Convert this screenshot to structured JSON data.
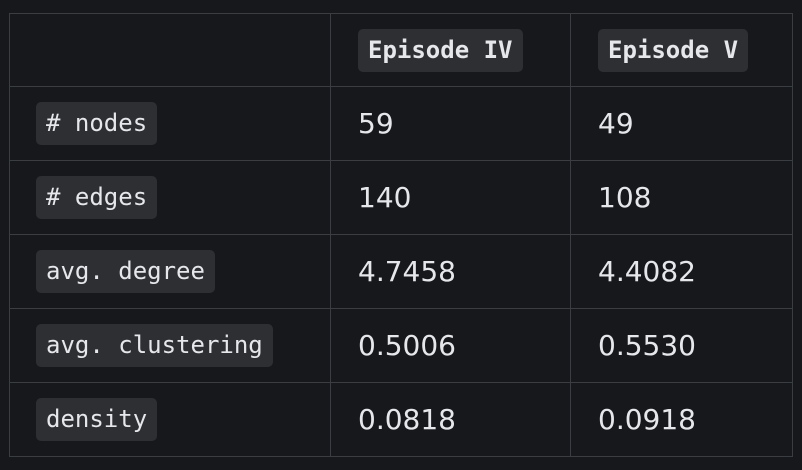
{
  "table": {
    "headers": [
      "",
      "Episode IV",
      "Episode V"
    ],
    "rows": [
      {
        "label": "# nodes",
        "values": [
          "59",
          "49"
        ]
      },
      {
        "label": "# edges",
        "values": [
          "140",
          "108"
        ]
      },
      {
        "label": "avg. degree",
        "values": [
          "4.7458",
          "4.4082"
        ]
      },
      {
        "label": "avg. clustering",
        "values": [
          "0.5006",
          "0.5530"
        ]
      },
      {
        "label": "density",
        "values": [
          "0.0818",
          "0.0918"
        ]
      }
    ]
  },
  "colors": {
    "background": "#17181b",
    "border": "#3a3d42",
    "code_background": "#2d2f33",
    "text": "#e6e7ea"
  }
}
